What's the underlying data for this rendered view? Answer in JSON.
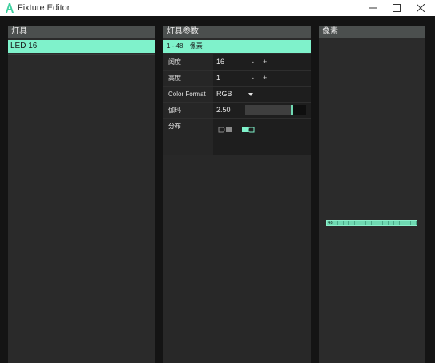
{
  "window": {
    "title": "Fixture Editor",
    "controls": [
      "minimize",
      "maximize",
      "close"
    ]
  },
  "colors": {
    "accent": "#7ff2cb",
    "panel_header": "#4b4f4e",
    "panel_bg": "#2a2a2a",
    "window_bg": "#141414"
  },
  "fixtures_panel": {
    "header": "灯具",
    "items": [
      {
        "label": "LED 16",
        "selected": true
      }
    ]
  },
  "params_panel": {
    "header": "灯具参数",
    "range": {
      "text": "1 - 48",
      "unit": "像素"
    },
    "rows": {
      "width": {
        "label": "阔度",
        "value": "16",
        "minus": "-",
        "plus": "+"
      },
      "height": {
        "label": "高度",
        "value": "1",
        "minus": "-",
        "plus": "+"
      },
      "color_format": {
        "label": "Color Format",
        "value": "RGB",
        "icon": "chevron-down-icon"
      },
      "gamma": {
        "label": "伽玛",
        "value": "2.50",
        "slider_fraction": 0.75
      },
      "distribution": {
        "label": "分布",
        "options": [
          "linear-distribution-icon",
          "snake-distribution-icon"
        ],
        "selected_index": 1
      }
    }
  },
  "pixels_panel": {
    "header": "像素",
    "strip_label": "48",
    "pixel_count": 16
  }
}
